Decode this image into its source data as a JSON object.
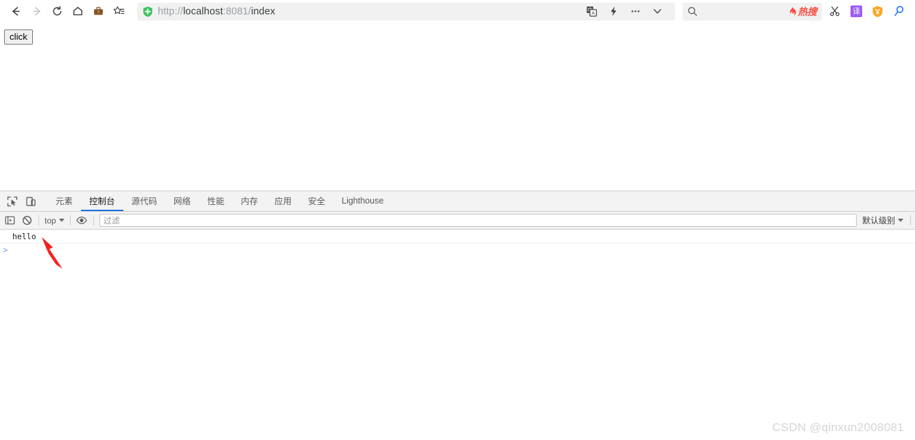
{
  "browser": {
    "nav": {
      "back_label": "Back",
      "forward_label": "Forward",
      "reload_label": "Reload",
      "home_label": "Home",
      "briefcase_label": "Collections",
      "favorites_label": "Favorites"
    },
    "url": {
      "security_icon": "shield-plus-icon",
      "scheme": "http://",
      "host": "localhost",
      "port_path": ":8081/",
      "page": "index",
      "full": "http://localhost:8081/index"
    },
    "url_actions": [
      {
        "name": "translate-icon",
        "label": "翻译"
      },
      {
        "name": "lightning-icon",
        "label": "极速"
      },
      {
        "name": "more-icon",
        "label": "…"
      },
      {
        "name": "chevron-down-icon",
        "label": "更多"
      }
    ],
    "search": {
      "placeholder": "",
      "hot_label": "热搜"
    },
    "extensions": [
      {
        "name": "scissors-icon",
        "label": "截图"
      },
      {
        "name": "translate-badge-icon",
        "label": "译"
      },
      {
        "name": "shield-icon",
        "label": "安全"
      },
      {
        "name": "magnifier-icon",
        "label": "搜索"
      }
    ]
  },
  "page": {
    "button_label": "click"
  },
  "devtools": {
    "tools": [
      {
        "name": "inspect-element-icon",
        "label": "检查元素"
      },
      {
        "name": "device-toolbar-icon",
        "label": "设备模拟"
      }
    ],
    "tabs": [
      {
        "label": "元素",
        "active": false
      },
      {
        "label": "控制台",
        "active": true
      },
      {
        "label": "源代码",
        "active": false
      },
      {
        "label": "网络",
        "active": false
      },
      {
        "label": "性能",
        "active": false
      },
      {
        "label": "内存",
        "active": false
      },
      {
        "label": "应用",
        "active": false
      },
      {
        "label": "安全",
        "active": false
      },
      {
        "label": "Lighthouse",
        "active": false
      }
    ],
    "console_toolbar": {
      "sidebar_toggle": "console-sidebar-icon",
      "clear_console": "clear-console-icon",
      "context_selector": "top",
      "eye_icon": "live-expression-icon",
      "filter_placeholder": "过滤",
      "level_selector": "默认级别"
    },
    "console_messages": [
      {
        "text": "hello"
      }
    ],
    "prompt_symbol": ">"
  },
  "annotation": {
    "arrow_color": "#f5201f"
  },
  "watermark": {
    "text": "CSDN @qinxun2008081"
  },
  "colors": {
    "accent_blue": "#1a73e8",
    "hot_red": "#f94f43",
    "shield_green": "#3dc25f",
    "toolbar_bg": "#f3f3f3"
  }
}
